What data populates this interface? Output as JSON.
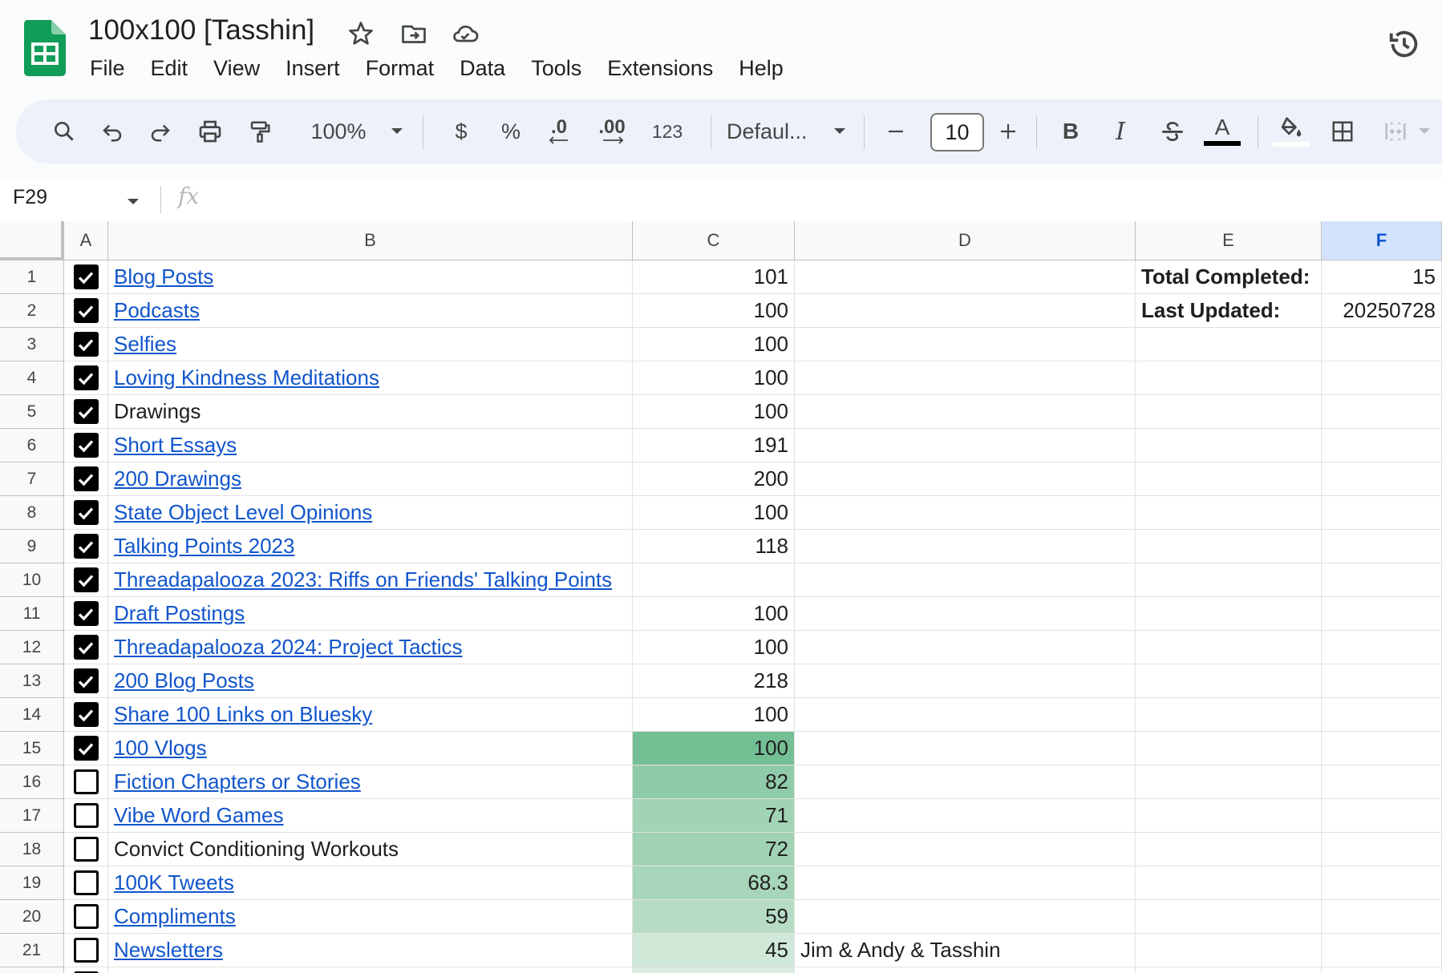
{
  "app": {
    "doc_title": "100x100 [Tasshin]",
    "menu": [
      "File",
      "Edit",
      "View",
      "Insert",
      "Format",
      "Data",
      "Tools",
      "Extensions",
      "Help"
    ]
  },
  "toolbar": {
    "zoom": "100%",
    "currency": "$",
    "percent": "%",
    "dec_decrease": ".0",
    "dec_increase": ".00",
    "number_format": "123",
    "font": "Defaul...",
    "font_size": "10",
    "bold": "B",
    "italic": "I",
    "text_color": "A"
  },
  "formula_bar": {
    "cell_ref": "F29",
    "fx": "fx"
  },
  "columns": [
    {
      "letter": "A",
      "selected": false
    },
    {
      "letter": "B",
      "selected": false
    },
    {
      "letter": "C",
      "selected": false
    },
    {
      "letter": "D",
      "selected": false
    },
    {
      "letter": "E",
      "selected": false
    },
    {
      "letter": "F",
      "selected": true
    }
  ],
  "rows": [
    {
      "num": "1",
      "checked": true,
      "name": "Blog Posts",
      "link": true,
      "count": "101",
      "note": "",
      "e": "Total Completed:",
      "f": "15",
      "fill": ""
    },
    {
      "num": "2",
      "checked": true,
      "name": "Podcasts",
      "link": true,
      "count": "100",
      "note": "",
      "e": "Last Updated:",
      "f": "20250728",
      "fill": ""
    },
    {
      "num": "3",
      "checked": true,
      "name": "Selfies",
      "link": true,
      "count": "100",
      "note": "",
      "e": "",
      "f": "",
      "fill": ""
    },
    {
      "num": "4",
      "checked": true,
      "name": "Loving Kindness Meditations",
      "link": true,
      "count": "100",
      "note": "",
      "e": "",
      "f": "",
      "fill": ""
    },
    {
      "num": "5",
      "checked": true,
      "name": "Drawings",
      "link": false,
      "count": "100",
      "note": "",
      "e": "",
      "f": "",
      "fill": ""
    },
    {
      "num": "6",
      "checked": true,
      "name": "Short Essays",
      "link": true,
      "count": "191",
      "note": "",
      "e": "",
      "f": "",
      "fill": ""
    },
    {
      "num": "7",
      "checked": true,
      "name": "200 Drawings",
      "link": true,
      "count": "200",
      "note": "",
      "e": "",
      "f": "",
      "fill": ""
    },
    {
      "num": "8",
      "checked": true,
      "name": "State Object Level Opinions",
      "link": true,
      "count": "100",
      "note": "",
      "e": "",
      "f": "",
      "fill": ""
    },
    {
      "num": "9",
      "checked": true,
      "name": "Talking Points 2023",
      "link": true,
      "count": "118",
      "note": "",
      "e": "",
      "f": "",
      "fill": ""
    },
    {
      "num": "10",
      "checked": true,
      "name": "Threadapalooza 2023: Riffs on Friends' Talking Points",
      "link": true,
      "count": "",
      "note": "",
      "e": "",
      "f": "",
      "fill": ""
    },
    {
      "num": "11",
      "checked": true,
      "name": "Draft Postings",
      "link": true,
      "count": "100",
      "note": "",
      "e": "",
      "f": "",
      "fill": ""
    },
    {
      "num": "12",
      "checked": true,
      "name": "Threadapalooza 2024: Project Tactics",
      "link": true,
      "count": "100",
      "note": "",
      "e": "",
      "f": "",
      "fill": ""
    },
    {
      "num": "13",
      "checked": true,
      "name": "200 Blog Posts",
      "link": true,
      "count": "218",
      "note": "",
      "e": "",
      "f": "",
      "fill": ""
    },
    {
      "num": "14",
      "checked": true,
      "name": "Share 100 Links on Bluesky",
      "link": true,
      "count": "100",
      "note": "",
      "e": "",
      "f": "",
      "fill": ""
    },
    {
      "num": "15",
      "checked": true,
      "name": "100 Vlogs",
      "link": true,
      "count": "100",
      "note": "",
      "e": "",
      "f": "",
      "fill": "#74be94"
    },
    {
      "num": "16",
      "checked": false,
      "name": "Fiction Chapters or Stories",
      "link": true,
      "count": "82",
      "note": "",
      "e": "",
      "f": "",
      "fill": "#90cba9"
    },
    {
      "num": "17",
      "checked": false,
      "name": "Vibe Word Games",
      "link": true,
      "count": "71",
      "note": "",
      "e": "",
      "f": "",
      "fill": "#a1d3b5"
    },
    {
      "num": "18",
      "checked": false,
      "name": "Convict Conditioning Workouts",
      "link": false,
      "count": "72",
      "note": "",
      "e": "",
      "f": "",
      "fill": "#a0d2b4"
    },
    {
      "num": "19",
      "checked": false,
      "name": "100K Tweets",
      "link": true,
      "count": "68.3",
      "note": "",
      "e": "",
      "f": "",
      "fill": "#a6d5b9"
    },
    {
      "num": "20",
      "checked": false,
      "name": "Compliments",
      "link": true,
      "count": "59",
      "note": "",
      "e": "",
      "f": "",
      "fill": "#b6dcc5"
    },
    {
      "num": "21",
      "checked": false,
      "name": "Newsletters",
      "link": true,
      "count": "45",
      "note": "Jim & Andy & Tasshin",
      "e": "",
      "f": "",
      "fill": "#cfe8d8"
    },
    {
      "num": "",
      "checked": false,
      "name": "",
      "link": false,
      "count": "",
      "note": "",
      "e": "",
      "f": "",
      "fill": "#d8ecdf"
    }
  ],
  "colors": {
    "link": "#1155cc",
    "selected_header": "#d3e3fd",
    "sheets_green": "#0f9d58"
  }
}
